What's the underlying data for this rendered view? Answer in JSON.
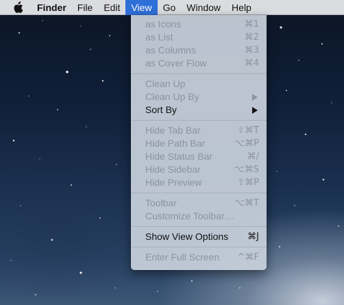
{
  "menubar": {
    "apple_icon": "apple-logo-icon",
    "app_name": "Finder",
    "items": [
      "File",
      "Edit",
      "View",
      "Go",
      "Window",
      "Help"
    ],
    "active": "View"
  },
  "view_menu": {
    "groups": [
      [
        {
          "label": "as Icons",
          "shortcut": "⌘1",
          "enabled": false
        },
        {
          "label": "as List",
          "shortcut": "⌘2",
          "enabled": false
        },
        {
          "label": "as Columns",
          "shortcut": "⌘3",
          "enabled": false
        },
        {
          "label": "as Cover Flow",
          "shortcut": "⌘4",
          "enabled": false
        }
      ],
      [
        {
          "label": "Clean Up",
          "shortcut": "",
          "enabled": false
        },
        {
          "label": "Clean Up By",
          "shortcut": "",
          "submenu": true,
          "enabled": false
        },
        {
          "label": "Sort By",
          "shortcut": "",
          "submenu": true,
          "enabled": true
        }
      ],
      [
        {
          "label": "Hide Tab Bar",
          "shortcut": "⇧⌘T",
          "enabled": false
        },
        {
          "label": "Hide Path Bar",
          "shortcut": "⌥⌘P",
          "enabled": false
        },
        {
          "label": "Hide Status Bar",
          "shortcut": "⌘/",
          "enabled": false
        },
        {
          "label": "Hide Sidebar",
          "shortcut": "⌥⌘S",
          "enabled": false
        },
        {
          "label": "Hide Preview",
          "shortcut": "⇧⌘P",
          "enabled": false
        }
      ],
      [
        {
          "label": "Toolbar",
          "shortcut": "⌥⌘T",
          "enabled": false
        },
        {
          "label": "Customize Toolbar…",
          "shortcut": "",
          "enabled": false
        }
      ],
      [
        {
          "label": "Show View Options",
          "shortcut": "⌘J",
          "enabled": true
        }
      ],
      [
        {
          "label": "Enter Full Screen",
          "shortcut": "^⌘F",
          "enabled": false
        }
      ]
    ]
  },
  "colors": {
    "menubar_bg": "#ECECEE",
    "active_menu_bg": "#2E6FD8",
    "menu_bg": "#C8D1DC",
    "disabled_text": "#8B93A0",
    "enabled_text": "#111111"
  }
}
